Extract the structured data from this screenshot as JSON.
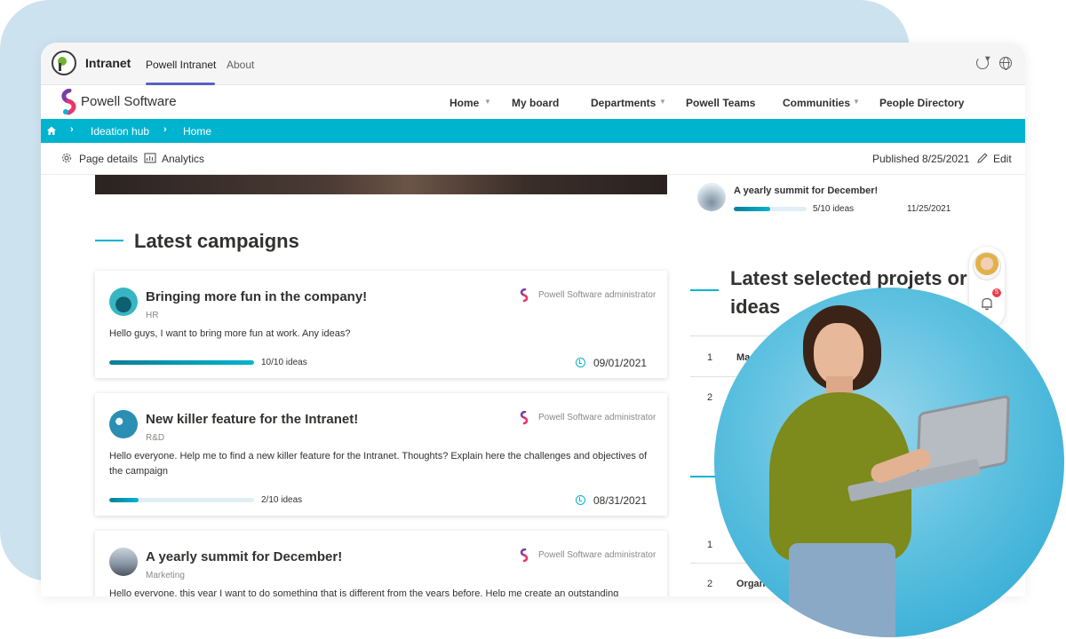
{
  "teams": {
    "app_name": "Intranet",
    "tabs": [
      {
        "label": "Powell Intranet"
      },
      {
        "label": "About"
      }
    ]
  },
  "site": {
    "brand": "Powell Software",
    "nav": [
      {
        "label": "Home"
      },
      {
        "label": "My board"
      },
      {
        "label": "Departments"
      },
      {
        "label": "Powell Teams"
      },
      {
        "label": "Communities"
      },
      {
        "label": "People Directory"
      }
    ]
  },
  "breadcrumb": [
    {
      "label": "Ideation hub"
    },
    {
      "label": "Home"
    }
  ],
  "command_bar": {
    "page_details": "Page details",
    "analytics": "Analytics",
    "published": "Published 8/25/2021",
    "edit": "Edit"
  },
  "main": {
    "section_title": "Latest campaigns",
    "campaigns": [
      {
        "title": "Bringing more fun in the company!",
        "dept": "HR",
        "author": "Powell Software administrator",
        "desc": "Hello guys, I want to bring more fun at work. Any ideas?",
        "ideas_label": "10/10 ideas",
        "progress": 1.0,
        "date": "09/01/2021"
      },
      {
        "title": "New killer feature for the Intranet!",
        "dept": "R&D",
        "author": "Powell Software administrator",
        "desc": "Hello everyone. Help me to find a new killer feature for the Intranet. Thoughts? Explain here the challenges and objectives of the campaign",
        "ideas_label": "2/10 ideas",
        "progress": 0.2,
        "date": "08/31/2021"
      },
      {
        "title": "A yearly summit for December!",
        "dept": "Marketing",
        "author": "Powell Software administrator",
        "desc": "Hello everyone, this year I want to do something that is different from the years before. Help me create an outstanding"
      }
    ]
  },
  "side": {
    "top_item": {
      "title": "A yearly summit for December!",
      "ideas_label": "5/10 ideas",
      "progress": 0.5,
      "date": "11/25/2021"
    },
    "section_title": "Latest selected projets or ideas",
    "rows_top": [
      {
        "num": "1",
        "text": "Ma"
      },
      {
        "num": "2",
        "text": ""
      }
    ],
    "rows_bottom": [
      {
        "num": "1",
        "text": ""
      },
      {
        "num": "2",
        "text": "Organ"
      }
    ],
    "notification_count": "5"
  },
  "colors": {
    "accent": "#00b4d0",
    "teams_purple": "#5b5fc7",
    "badge": "#e8414b"
  }
}
